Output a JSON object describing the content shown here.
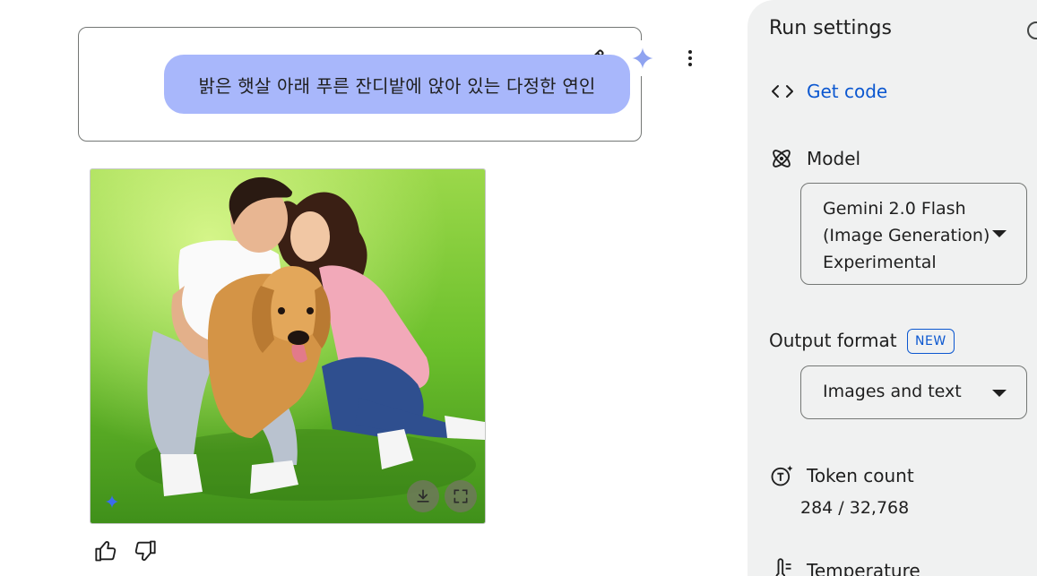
{
  "prompt": {
    "text": "밝은 햇살 아래 푸른 잔디밭에 앉아 있는 다정한 연인",
    "actions": [
      "edit-icon",
      "sparkle-icon",
      "more-vert-icon"
    ]
  },
  "image": {
    "alt_icons": [
      "download-icon",
      "fullscreen-icon",
      "sparkle-icon"
    ]
  },
  "feedback": {
    "icons": [
      "thumb-up-icon",
      "thumb-down-icon"
    ]
  },
  "panel": {
    "title": "Run settings",
    "get_code_label": "Get code",
    "model_label": "Model",
    "model_value_line1": "Gemini 2.0 Flash",
    "model_value_line2": "(Image Generation)",
    "model_value_line3": "Experimental",
    "output_format_label": "Output format",
    "new_badge": "NEW",
    "output_format_value": "Images and text",
    "token_count_label": "Token count",
    "token_count_value": "284 / 32,768",
    "temperature_label": "Temperature"
  },
  "colors": {
    "bubble": "#a8b7fb",
    "link": "#0b57d0",
    "panel_bg": "#f0f1f1",
    "border": "#747775"
  }
}
